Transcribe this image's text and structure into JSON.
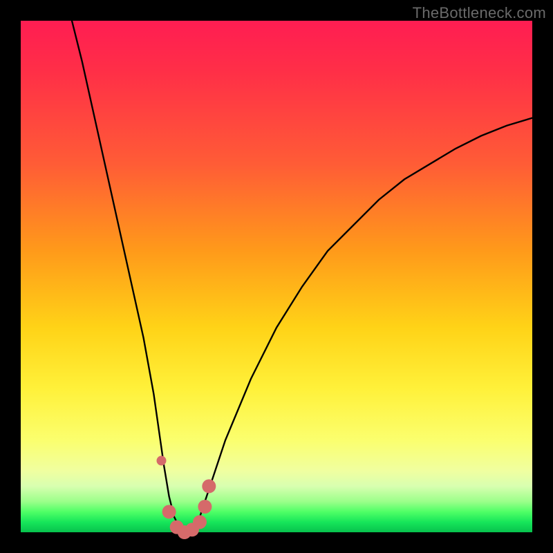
{
  "watermark": "TheBottleneck.com",
  "chart_data": {
    "type": "line",
    "title": "",
    "xlabel": "",
    "ylabel": "",
    "xlim": [
      0,
      100
    ],
    "ylim": [
      0,
      100
    ],
    "grid": false,
    "legend": false,
    "annotations": [],
    "series": [
      {
        "name": "bottleneck-curve",
        "color": "#000000",
        "x": [
          10,
          12,
          14,
          16,
          18,
          20,
          22,
          24,
          26,
          27,
          28,
          29,
          30,
          31,
          32,
          33,
          34,
          35,
          36,
          38,
          40,
          45,
          50,
          55,
          60,
          65,
          70,
          75,
          80,
          85,
          90,
          95,
          100
        ],
        "y": [
          100,
          92,
          83,
          74,
          65,
          56,
          47,
          38,
          27,
          20,
          13,
          7,
          3,
          1,
          0,
          0,
          1,
          3,
          6,
          12,
          18,
          30,
          40,
          48,
          55,
          60,
          65,
          69,
          72,
          75,
          77.5,
          79.5,
          81
        ]
      }
    ],
    "highlight": {
      "name": "bottom-markers",
      "color": "#d56a6a",
      "points": [
        {
          "x": 27.5,
          "y": 14
        },
        {
          "x": 29.0,
          "y": 4
        },
        {
          "x": 30.5,
          "y": 1
        },
        {
          "x": 32.0,
          "y": 0
        },
        {
          "x": 33.5,
          "y": 0.5
        },
        {
          "x": 35.0,
          "y": 2
        },
        {
          "x": 36.0,
          "y": 5
        },
        {
          "x": 36.8,
          "y": 9
        }
      ]
    },
    "gradient_stops": [
      {
        "pos": 0,
        "color": "#ff1d52"
      },
      {
        "pos": 10,
        "color": "#ff2f47"
      },
      {
        "pos": 28,
        "color": "#ff5c36"
      },
      {
        "pos": 45,
        "color": "#ff9a1a"
      },
      {
        "pos": 60,
        "color": "#ffd317"
      },
      {
        "pos": 72,
        "color": "#fff13a"
      },
      {
        "pos": 82,
        "color": "#fbff6e"
      },
      {
        "pos": 88,
        "color": "#f0ffa0"
      },
      {
        "pos": 91,
        "color": "#d8ffb0"
      },
      {
        "pos": 94,
        "color": "#9bff8a"
      },
      {
        "pos": 96,
        "color": "#4fff66"
      },
      {
        "pos": 98,
        "color": "#17e65a"
      },
      {
        "pos": 100,
        "color": "#07c24d"
      }
    ]
  }
}
